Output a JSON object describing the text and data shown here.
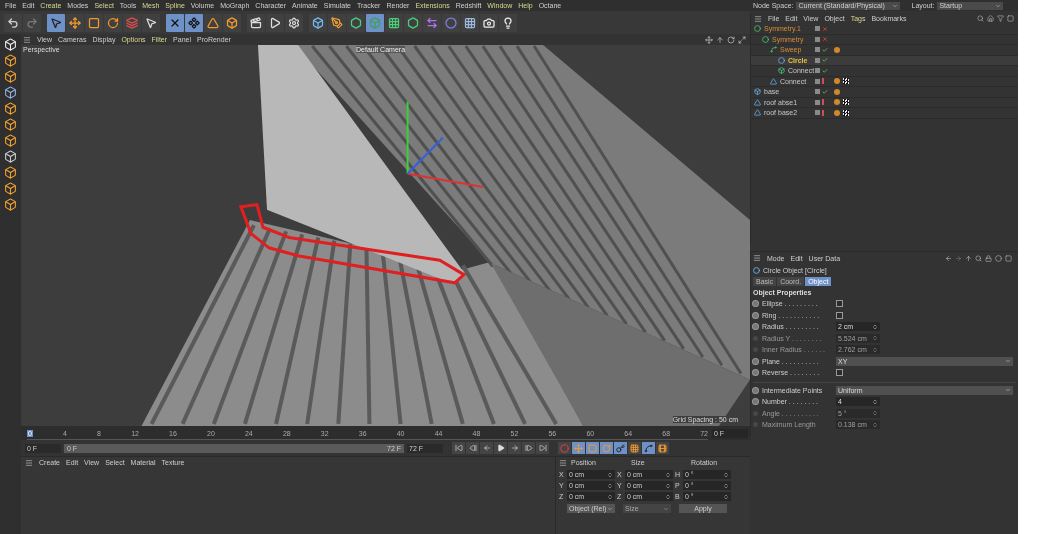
{
  "menu_bar": [
    {
      "label": "File",
      "highlighted": false
    },
    {
      "label": "Edit",
      "highlighted": false
    },
    {
      "label": "Create",
      "highlighted": true
    },
    {
      "label": "Modes",
      "highlighted": false
    },
    {
      "label": "Select",
      "highlighted": true
    },
    {
      "label": "Tools",
      "highlighted": false
    },
    {
      "label": "Mesh",
      "highlighted": true
    },
    {
      "label": "Spline",
      "highlighted": true
    },
    {
      "label": "Volume",
      "highlighted": false
    },
    {
      "label": "MoGraph",
      "highlighted": false
    },
    {
      "label": "Character",
      "highlighted": false
    },
    {
      "label": "Animate",
      "highlighted": false
    },
    {
      "label": "Simulate",
      "highlighted": false
    },
    {
      "label": "Tracker",
      "highlighted": false
    },
    {
      "label": "Render",
      "highlighted": false
    },
    {
      "label": "Extensions",
      "highlighted": true
    },
    {
      "label": "Redshift",
      "highlighted": false
    },
    {
      "label": "Window",
      "highlighted": true
    },
    {
      "label": "Help",
      "highlighted": true
    },
    {
      "label": "Octane",
      "highlighted": false
    }
  ],
  "node_space": {
    "label": "Node Space:",
    "value": "Current (Standard/Physical)"
  },
  "layout": {
    "label": "Layout:",
    "value": "Startup"
  },
  "toolbar": [
    {
      "kind": "undo",
      "selected": false
    },
    {
      "kind": "redo",
      "selected": false
    },
    {
      "kind": "select",
      "selected": true
    },
    {
      "kind": "move",
      "selected": false
    },
    {
      "kind": "scale",
      "selected": false
    },
    {
      "kind": "rotate",
      "selected": false
    },
    {
      "kind": "psr",
      "selected": false
    },
    {
      "kind": "live",
      "selected": false
    },
    {
      "kind": "x",
      "selected": true
    },
    {
      "kind": "y",
      "selected": true
    },
    {
      "kind": "z",
      "selected": false
    },
    {
      "kind": "coords",
      "selected": false
    },
    {
      "kind": "render-region",
      "selected": false
    },
    {
      "kind": "render",
      "selected": false
    },
    {
      "kind": "render-settings",
      "selected": false
    },
    {
      "kind": "cube",
      "selected": false
    },
    {
      "kind": "pen",
      "selected": false
    },
    {
      "kind": "subdivide",
      "selected": false
    },
    {
      "kind": "extrude",
      "selected": true
    },
    {
      "kind": "array",
      "selected": false
    },
    {
      "kind": "cloner",
      "selected": false
    },
    {
      "kind": "deformer",
      "selected": false
    },
    {
      "kind": "field",
      "selected": false
    },
    {
      "kind": "floor",
      "selected": false
    },
    {
      "kind": "camera",
      "selected": false
    },
    {
      "kind": "light",
      "selected": false
    }
  ],
  "viewport": {
    "menu": [
      {
        "label": "View",
        "highlighted": false
      },
      {
        "label": "Cameras",
        "highlighted": false
      },
      {
        "label": "Display",
        "highlighted": false
      },
      {
        "label": "Options",
        "highlighted": true
      },
      {
        "label": "Filter",
        "highlighted": true
      },
      {
        "label": "Panel",
        "highlighted": false
      },
      {
        "label": "ProRender",
        "highlighted": false
      }
    ],
    "view_name": "Perspective",
    "camera": "Default Camera",
    "grid_spacing": "Grid Spacing : 50 cm"
  },
  "timeline": {
    "ticks": [
      "0",
      "4",
      "8",
      "12",
      "16",
      "20",
      "24",
      "28",
      "32",
      "36",
      "40",
      "44",
      "48",
      "52",
      "56",
      "60",
      "64",
      "68",
      "72"
    ],
    "current_frame": "0 F",
    "start": "0 F",
    "range": {
      "start": "0 F",
      "end": "72 F",
      "level": 1
    },
    "end": "72 F",
    "key_toggles": [
      {
        "kind": "key",
        "selected": false
      },
      {
        "kind": "position",
        "selected": true
      },
      {
        "kind": "scale",
        "selected": true
      },
      {
        "kind": "rotation",
        "selected": true
      },
      {
        "kind": "parameter",
        "selected": true
      },
      {
        "kind": "point",
        "selected": false
      },
      {
        "kind": "motion",
        "selected": true
      },
      {
        "kind": "film",
        "selected": false
      }
    ]
  },
  "material_manager": {
    "menu": [
      "Create",
      "Edit",
      "View",
      "Select",
      "Material",
      "Texture"
    ]
  },
  "coordinates": {
    "headers": [
      "Position",
      "Size",
      "Rotation"
    ],
    "rows": [
      {
        "pos_axis": "X",
        "position": "0 cm",
        "size_axis": "X",
        "size": "0 cm",
        "rot_axis": "H",
        "rotation": "0 °"
      },
      {
        "pos_axis": "Y",
        "position": "0 cm",
        "size_axis": "Y",
        "size": "0 cm",
        "rot_axis": "P",
        "rotation": "0 °"
      },
      {
        "pos_axis": "Z",
        "position": "0 cm",
        "size_axis": "Z",
        "size": "0 cm",
        "rot_axis": "B",
        "rotation": "0 °"
      }
    ],
    "mode": "Object (Rel)",
    "size_mode": "Size",
    "apply": "Apply"
  },
  "object_manager": {
    "menu": [
      {
        "label": "File",
        "highlighted": false
      },
      {
        "label": "Edit",
        "highlighted": false
      },
      {
        "label": "View",
        "highlighted": false
      },
      {
        "label": "Object",
        "highlighted": false
      },
      {
        "label": "Tags",
        "highlighted": true
      },
      {
        "label": "Bookmarks",
        "highlighted": false
      }
    ],
    "objects": [
      {
        "name": "Symmetry.1",
        "kind": "symmetry",
        "selected": false,
        "enabled": false,
        "children": [
          {
            "name": "Symmetry",
            "kind": "symmetry",
            "selected": false,
            "enabled": false,
            "children": [
              {
                "name": "Sweep",
                "kind": "sweep",
                "selected": false,
                "enabled": true,
                "tags": [
                  {
                    "kind": "phong"
                  }
                ],
                "children": [
                  {
                    "name": "Circle",
                    "kind": "circle",
                    "selected": true,
                    "enabled": true
                  },
                  {
                    "name": "Connect",
                    "kind": "connect",
                    "selected": false,
                    "enabled": true
                  }
                ]
              },
              {
                "name": "Connect",
                "kind": "polygon",
                "selected": false,
                "tags": [
                  {
                    "kind": "phong"
                  },
                  {
                    "kind": "checker"
                  }
                ]
              }
            ]
          }
        ]
      },
      {
        "name": "base",
        "kind": "null",
        "selected": false,
        "enabled": true,
        "tags": [
          {
            "kind": "phong"
          }
        ]
      },
      {
        "name": "roof abse1",
        "kind": "polygon",
        "selected": false,
        "tags": [
          {
            "kind": "phong"
          },
          {
            "kind": "checker"
          }
        ]
      },
      {
        "name": "roof base2",
        "kind": "polygon",
        "selected": false,
        "tags": [
          {
            "kind": "phong"
          },
          {
            "kind": "checker"
          }
        ]
      }
    ]
  },
  "attributes": {
    "menu": [
      "Mode",
      "Edit",
      "User Data"
    ],
    "title": "Circle Object [Circle]",
    "tabs": [
      {
        "label": "Basic",
        "selected": false
      },
      {
        "label": "Coord.",
        "selected": false
      },
      {
        "label": "Object",
        "selected": true
      }
    ],
    "section": "Object Properties",
    "fields": [
      {
        "kind": "checkbox",
        "label": "Ellipse . . . . . . . . .",
        "checked": false,
        "disabled": false
      },
      {
        "kind": "checkbox",
        "label": "Ring . . . . . . . . . . .",
        "checked": false,
        "disabled": false
      },
      {
        "kind": "number",
        "label": "Radius . . . . . . . . .",
        "value": "2 cm",
        "disabled": false
      },
      {
        "kind": "number",
        "label": "Radius Y . . . . . . . .",
        "value": "5.524 cm",
        "disabled": true
      },
      {
        "kind": "number",
        "label": "Inner Radius . . . . . .",
        "value": "2.762 cm",
        "disabled": true
      },
      {
        "kind": "dropdown",
        "label": "Plane . . . . . . . . . .",
        "value": "XY",
        "disabled": false
      },
      {
        "kind": "checkbox",
        "label": "Reverse . . . . . . . .",
        "checked": false,
        "disabled": false
      },
      {
        "kind": "separator"
      },
      {
        "kind": "dropdown",
        "label": "Intermediate Points",
        "value": "Uniform",
        "disabled": false
      },
      {
        "kind": "number",
        "label": "Number . . . . . . . .",
        "value": "4",
        "disabled": false
      },
      {
        "kind": "number",
        "label": "Angle . . . . . . . . . .",
        "value": "5 °",
        "disabled": true
      },
      {
        "kind": "number",
        "label": "Maximum Length",
        "value": "0.138 cm",
        "disabled": true
      }
    ]
  }
}
